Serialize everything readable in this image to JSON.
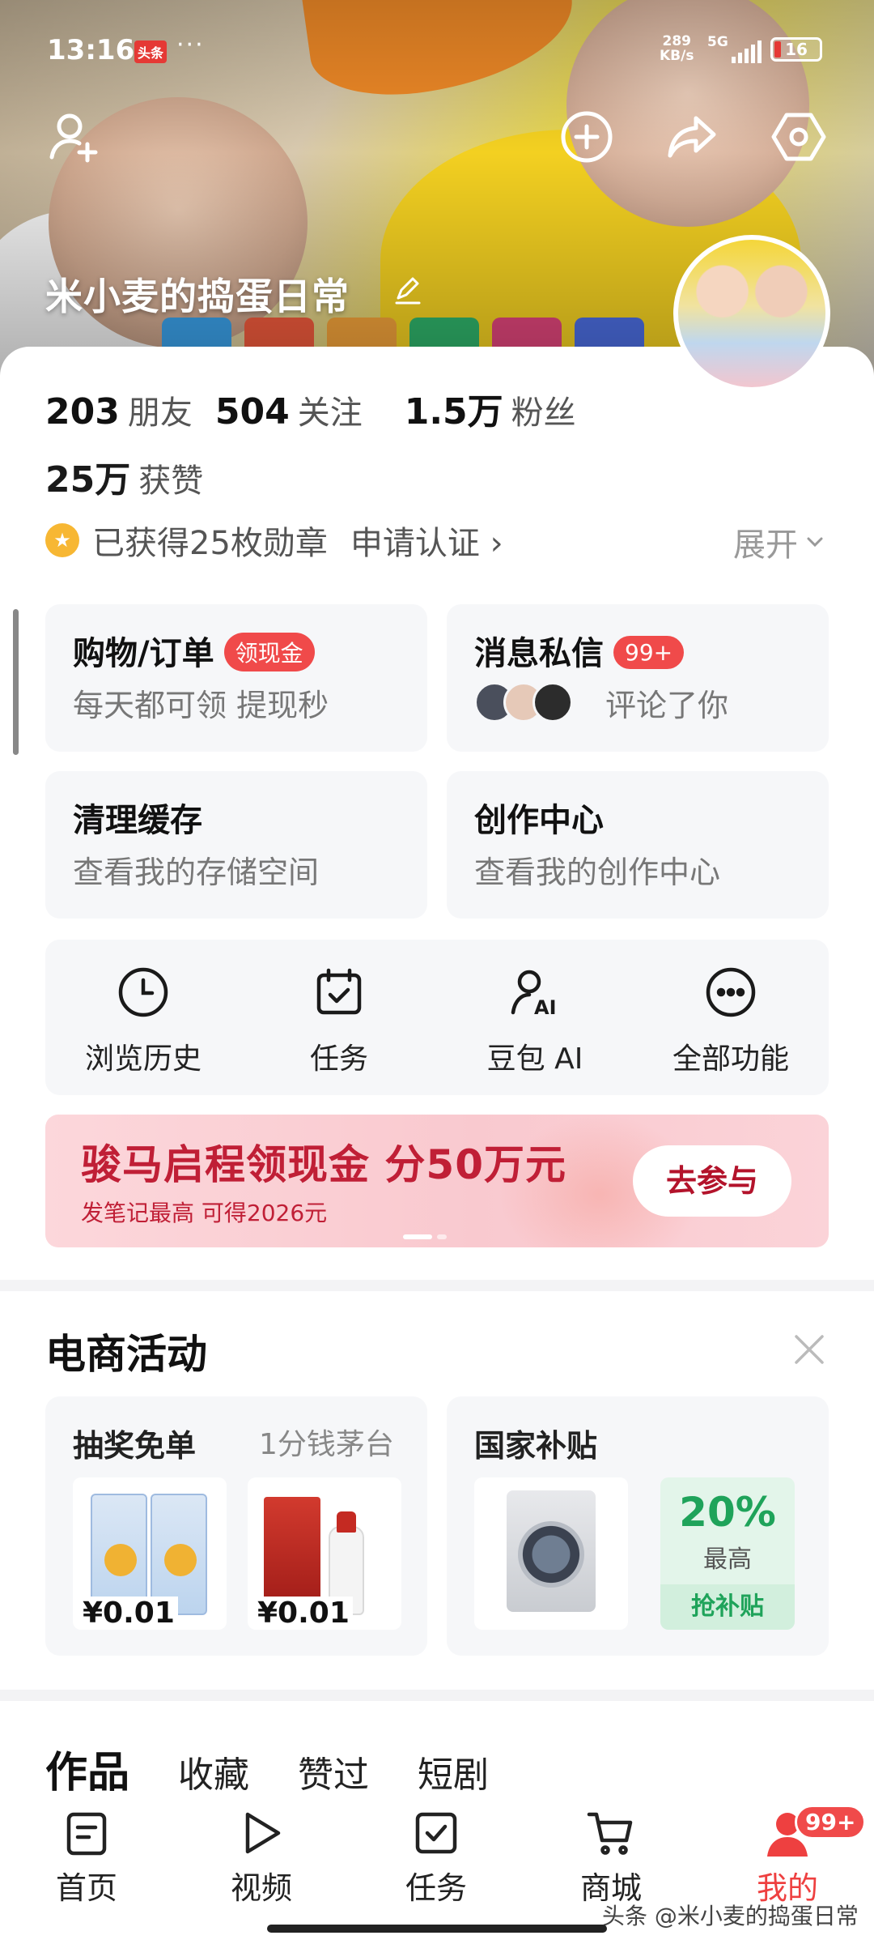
{
  "status_bar": {
    "time": "13:16",
    "app_badge": "头条",
    "more": "···",
    "speed_value": "289",
    "speed_unit": "KB/s",
    "network": "5G",
    "battery": "16"
  },
  "profile": {
    "name": "米小麦的捣蛋日常",
    "stats": [
      {
        "value": "203",
        "label": "朋友"
      },
      {
        "value": "504",
        "label": "关注"
      },
      {
        "value": "1.5万",
        "label": "粉丝"
      }
    ],
    "likes": {
      "value": "25万",
      "label": "获赞"
    },
    "badges_text": "已获得25枚勋章",
    "verify_text": "申请认证",
    "expand_text": "展开"
  },
  "cards": {
    "shopping": {
      "title": "购物/订单",
      "pill": "领现金",
      "subtitle": "每天都可领 提现秒"
    },
    "messages": {
      "title": "消息私信",
      "pill": "99+",
      "subtitle": "评论了你"
    },
    "cache": {
      "title": "清理缓存",
      "subtitle": "查看我的存储空间"
    },
    "creator": {
      "title": "创作中心",
      "subtitle": "查看我的创作中心"
    }
  },
  "shortcuts": [
    {
      "label": "浏览历史",
      "icon": "clock-icon"
    },
    {
      "label": "任务",
      "icon": "calendar-check-icon"
    },
    {
      "label": "豆包 AI",
      "icon": "ai-person-icon"
    },
    {
      "label": "全部功能",
      "icon": "more-circle-icon"
    }
  ],
  "banner": {
    "title": "骏马启程领现金 分50万元",
    "subtitle": "发笔记最高 可得2026元",
    "button": "去参与"
  },
  "ecommerce": {
    "title": "电商活动",
    "lottery": {
      "title": "抽奖免单",
      "subtitle": "1分钱茅台",
      "price1": "¥0.01",
      "price2": "¥0.01"
    },
    "subsidy": {
      "title": "国家补贴",
      "percent": "20%",
      "max_label": "最高",
      "grab": "抢补贴"
    }
  },
  "content_tabs": [
    "作品",
    "收藏",
    "赞过",
    "短剧"
  ],
  "bottom_nav": [
    {
      "label": "首页",
      "icon": "home-doc-icon"
    },
    {
      "label": "视频",
      "icon": "play-icon"
    },
    {
      "label": "任务",
      "icon": "task-check-icon"
    },
    {
      "label": "商城",
      "icon": "cart-icon"
    },
    {
      "label": "我的",
      "icon": "person-icon"
    }
  ],
  "nav_badge": "99+",
  "watermark": "头条 @米小麦的捣蛋日常",
  "colors": {
    "accent": "#ee4040",
    "pill": "#f04a4a",
    "banner_text": "#c01f36",
    "subsidy_green": "#1fa35a"
  }
}
